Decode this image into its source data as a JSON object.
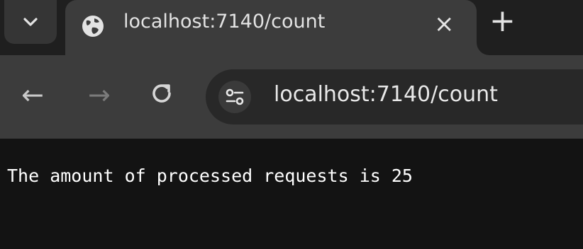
{
  "browser": {
    "tab": {
      "title": "localhost:7140/count",
      "close_glyph": "×",
      "favicon": "globe-icon"
    },
    "new_tab_glyph": "+",
    "tab_search_icon": "chevron-down-icon",
    "toolbar": {
      "back_glyph": "←",
      "forward_glyph": "→",
      "reload_icon": "reload-icon",
      "site_info_icon": "tune-icon"
    },
    "address": "localhost:7140/count"
  },
  "page": {
    "body_text": "The amount of processed requests is 25"
  },
  "colors": {
    "tabstrip": "#1f1f1f",
    "active_tab": "#3c3c3c",
    "omnibox": "#282828",
    "page_background": "#131313",
    "text": "#ffffff"
  }
}
